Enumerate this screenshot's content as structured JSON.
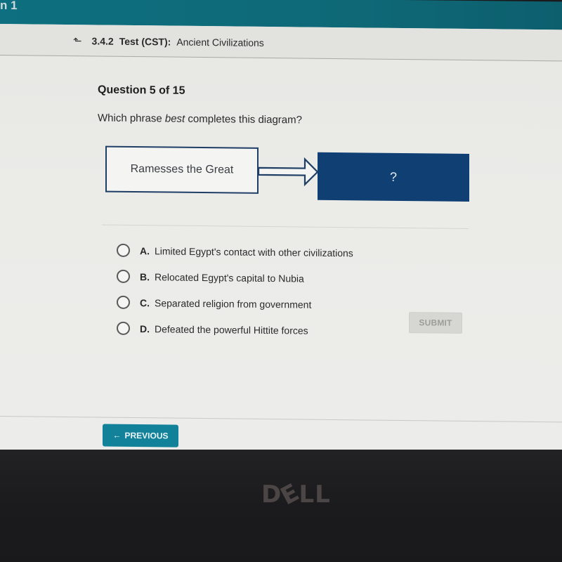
{
  "topbar": {
    "partial_text": "n 1"
  },
  "header": {
    "back_icon": "up-arrow-icon",
    "code": "3.4.2",
    "title": "Test (CST):",
    "subtitle": "Ancient Civilizations"
  },
  "question": {
    "number_label": "Question 5 of 15",
    "prompt_before": "Which phrase ",
    "prompt_emphasis": "best",
    "prompt_after": " completes this diagram?"
  },
  "diagram": {
    "left_box": "Ramesses the Great",
    "right_box": "?",
    "colors": {
      "left_border": "#1f3e66",
      "right_fill": "#0f3f73"
    }
  },
  "options": [
    {
      "letter": "A.",
      "text": "Limited Egypt's contact with other civilizations",
      "selected": false
    },
    {
      "letter": "B.",
      "text": "Relocated Egypt's capital to Nubia",
      "selected": false
    },
    {
      "letter": "C.",
      "text": "Separated religion from government",
      "selected": false
    },
    {
      "letter": "D.",
      "text": "Defeated the powerful Hittite forces",
      "selected": false
    }
  ],
  "buttons": {
    "submit": "SUBMIT",
    "previous": "PREVIOUS",
    "previous_icon": "arrow-left-icon"
  },
  "bezel": {
    "brand": "DELL"
  },
  "colors": {
    "topbar": "#0e6977",
    "previous_button": "#12829a",
    "submit_disabled": "#d6d6d3"
  }
}
